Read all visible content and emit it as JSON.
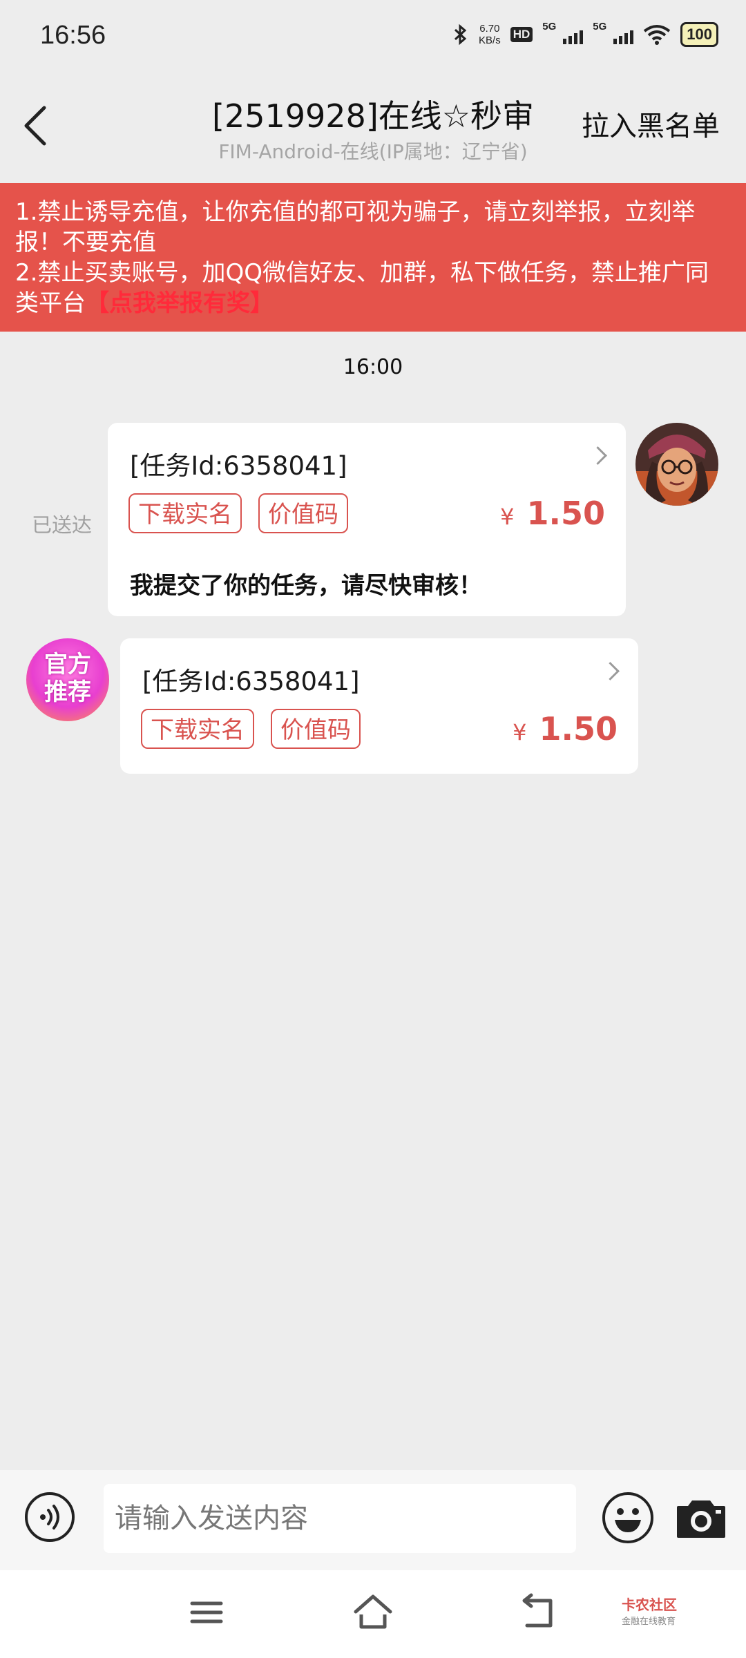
{
  "status_bar": {
    "time": "16:56",
    "net_speed_value": "6.70",
    "net_speed_unit": "KB/s",
    "hd_label": "HD",
    "sim1_label": "5G",
    "sim2_label": "5G",
    "battery": "100"
  },
  "header": {
    "title": "[2519928]在线☆秒审",
    "subtitle": "FIM-Android-在线(IP属地：辽宁省)",
    "blacklist_label": "拉入黑名单"
  },
  "warning": {
    "line1": "1.禁止诱导充值，让你充值的都可视为骗子，请立刻举报，立刻举报！不要充值",
    "line2": "2.禁止买卖账号，加QQ微信好友、加群，私下做任务，禁止推广同类平台",
    "report_link": "【点我举报有奖】"
  },
  "chat": {
    "time": "16:00",
    "messages": [
      {
        "task_id": "[任务Id:6358041]",
        "tags": [
          "下载实名",
          "价值码"
        ],
        "currency": "¥",
        "price": "1.50",
        "text": "我提交了你的任务，请尽快审核！",
        "status": "已送达"
      },
      {
        "avatar_text_line1": "官方",
        "avatar_text_line2": "推荐",
        "task_id": "[任务Id:6358041]",
        "tags": [
          "下载实名",
          "价值码"
        ],
        "currency": "¥",
        "price": "1.50"
      }
    ]
  },
  "input": {
    "placeholder": "请输入发送内容"
  },
  "watermark": {
    "name": "卡农社区",
    "sub": "金融在线教育"
  },
  "colors": {
    "background": "#ededed",
    "banner": "#e5534b",
    "accent_red": "#d9534f",
    "bubble": "#ffffff"
  }
}
